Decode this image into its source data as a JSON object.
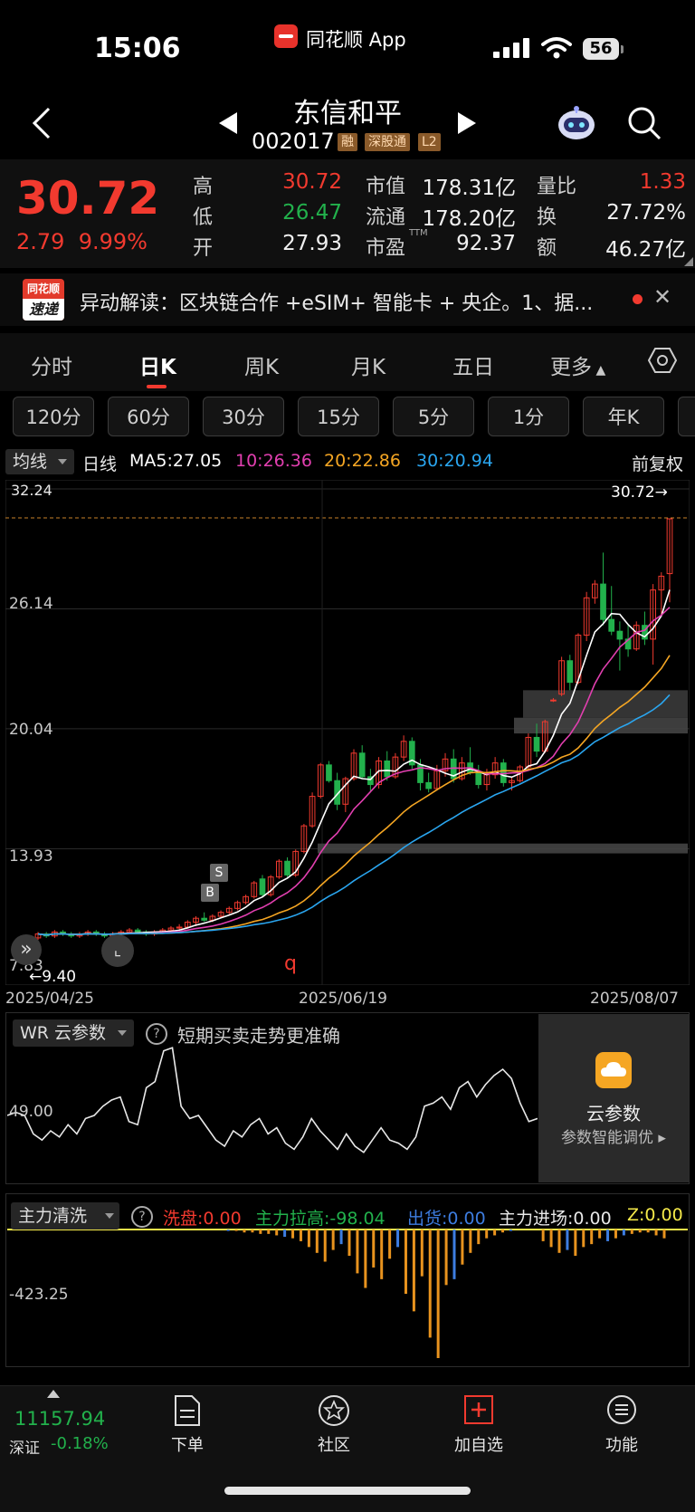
{
  "status_bar": {
    "time": "15:06",
    "app": "同花顺 App",
    "battery": "56"
  },
  "header": {
    "name": "东信和平",
    "code": "002017",
    "tags": [
      "融",
      "深股通",
      "L2"
    ]
  },
  "quote": {
    "price": "30.72",
    "change": "2.79",
    "change_pct": "9.99%",
    "rows": [
      {
        "l1": "高",
        "v1": "30.72",
        "c1": "#f23a2f",
        "l2": "市值",
        "v2": "178.31亿",
        "l3": "量比",
        "v3": "1.33",
        "c3": "#f23a2f"
      },
      {
        "l1": "低",
        "v1": "26.47",
        "c1": "#22b14c",
        "l2": "流通",
        "v2": "178.20亿",
        "l3": "换",
        "v3": "27.72%",
        "c3": "#f0f0f0"
      },
      {
        "l1": "开",
        "v1": "27.93",
        "c1": "#f0f0f0",
        "l2": "市盈",
        "v2": "92.37",
        "l3": "额",
        "v3": "46.27亿",
        "c3": "#f0f0f0"
      }
    ],
    "ttm": "TTM"
  },
  "news": {
    "logo_top": "同花顺",
    "logo_bottom": "速递",
    "text": "异动解读：区块链合作 +eSIM+ 智能卡 + 央企。1、据..."
  },
  "period_tabs": [
    "分时",
    "日K",
    "周K",
    "月K",
    "五日",
    "更多"
  ],
  "minute_buttons": [
    "120分",
    "60分",
    "30分",
    "15分",
    "5分",
    "1分",
    "年K"
  ],
  "ma_bar": {
    "select": "均线",
    "label": "日线",
    "ma5": "MA5:27.05",
    "ma10": "10:26.36",
    "ma20": "20:22.86",
    "ma30": "30:20.94",
    "adjust": "前复权",
    "colors": {
      "ma5": "#ffffff",
      "ma10": "#e23fb0",
      "ma20": "#f5a623",
      "ma30": "#2aa6f0"
    }
  },
  "kline": {
    "y_labels": [
      "32.24",
      "26.14",
      "20.04",
      "13.93",
      "7.83"
    ],
    "price_marker": "30.72→",
    "low_marker": "←9.40",
    "dates": [
      "2025/04/25",
      "2025/06/19",
      "2025/08/07"
    ],
    "marker_b": "B",
    "marker_s": "S",
    "q_marker": "q"
  },
  "chart_data": [
    {
      "type": "candlestick",
      "title": "日线",
      "ylim": [
        7.83,
        32.24
      ],
      "x_ticks": [
        "2025/04/25",
        "2025/06/19",
        "2025/08/07"
      ],
      "last_close": 30.72,
      "min_marker": 9.4,
      "candles": [
        [
          9.4,
          9.7,
          9.3,
          9.6
        ],
        [
          9.6,
          9.7,
          9.4,
          9.5
        ],
        [
          9.5,
          9.8,
          9.4,
          9.7
        ],
        [
          9.7,
          9.8,
          9.5,
          9.6
        ],
        [
          9.6,
          9.7,
          9.4,
          9.5
        ],
        [
          9.5,
          9.7,
          9.4,
          9.6
        ],
        [
          9.6,
          9.8,
          9.5,
          9.7
        ],
        [
          9.7,
          9.8,
          9.5,
          9.6
        ],
        [
          9.6,
          9.7,
          9.4,
          9.5
        ],
        [
          9.5,
          9.7,
          9.4,
          9.6
        ],
        [
          9.6,
          9.8,
          9.5,
          9.7
        ],
        [
          9.7,
          9.9,
          9.6,
          9.8
        ],
        [
          9.8,
          9.9,
          9.6,
          9.7
        ],
        [
          9.7,
          9.8,
          9.5,
          9.6
        ],
        [
          9.6,
          9.8,
          9.5,
          9.7
        ],
        [
          9.7,
          9.9,
          9.6,
          9.8
        ],
        [
          9.8,
          10.0,
          9.7,
          9.9
        ],
        [
          9.9,
          10.1,
          9.8,
          9.95
        ],
        [
          9.95,
          10.3,
          9.9,
          10.2
        ],
        [
          10.2,
          10.5,
          10.0,
          10.4
        ],
        [
          10.4,
          10.7,
          10.2,
          10.3
        ],
        [
          10.3,
          10.6,
          10.2,
          10.5
        ],
        [
          10.5,
          10.8,
          10.4,
          10.7
        ],
        [
          10.7,
          11.0,
          10.6,
          10.9
        ],
        [
          10.9,
          11.3,
          10.8,
          11.2
        ],
        [
          11.2,
          11.6,
          11.1,
          11.5
        ],
        [
          11.5,
          12.3,
          11.4,
          12.2
        ],
        [
          12.4,
          12.6,
          11.5,
          11.6
        ],
        [
          11.6,
          12.6,
          11.5,
          12.5
        ],
        [
          12.5,
          13.4,
          12.4,
          13.3
        ],
        [
          13.3,
          13.5,
          12.5,
          12.6
        ],
        [
          12.6,
          13.9,
          12.5,
          13.8
        ],
        [
          13.8,
          15.2,
          13.7,
          15.1
        ],
        [
          15.1,
          16.8,
          15.0,
          16.6
        ],
        [
          16.6,
          18.3,
          16.5,
          18.2
        ],
        [
          18.2,
          18.4,
          17.3,
          17.4
        ],
        [
          17.4,
          17.8,
          15.9,
          16.2
        ],
        [
          16.2,
          17.6,
          15.8,
          17.5
        ],
        [
          17.5,
          19.0,
          17.4,
          18.8
        ],
        [
          18.8,
          19.2,
          17.5,
          17.6
        ],
        [
          17.6,
          18.0,
          16.8,
          17.2
        ],
        [
          17.2,
          18.6,
          17.0,
          18.4
        ],
        [
          18.4,
          18.9,
          17.4,
          17.6
        ],
        [
          17.6,
          18.8,
          17.5,
          18.6
        ],
        [
          18.6,
          19.7,
          18.4,
          19.4
        ],
        [
          19.4,
          19.6,
          18.0,
          18.2
        ],
        [
          18.2,
          18.5,
          16.9,
          17.3
        ],
        [
          17.3,
          17.8,
          16.8,
          17.0
        ],
        [
          17.0,
          18.2,
          16.9,
          17.9
        ],
        [
          17.9,
          18.8,
          17.6,
          18.5
        ],
        [
          18.5,
          19.0,
          17.3,
          17.5
        ],
        [
          17.5,
          18.6,
          17.4,
          18.3
        ],
        [
          18.3,
          19.1,
          17.7,
          17.8
        ],
        [
          17.8,
          18.2,
          17.0,
          17.2
        ],
        [
          17.2,
          18.0,
          16.9,
          17.7
        ],
        [
          17.7,
          18.6,
          17.5,
          18.3
        ],
        [
          18.3,
          18.5,
          17.1,
          17.3
        ],
        [
          17.3,
          17.6,
          16.9,
          17.4
        ],
        [
          17.4,
          18.2,
          17.3,
          18.1
        ],
        [
          18.1,
          19.8,
          18.0,
          19.6
        ],
        [
          19.6,
          20.3,
          18.6,
          18.9
        ],
        [
          18.9,
          20.5,
          18.8,
          20.4
        ],
        [
          21.5,
          21.6,
          21.4,
          21.5
        ],
        [
          21.8,
          23.7,
          21.7,
          23.5
        ],
        [
          23.5,
          23.8,
          22.0,
          22.4
        ],
        [
          22.4,
          24.9,
          22.3,
          24.8
        ],
        [
          24.8,
          27.0,
          24.5,
          26.7
        ],
        [
          26.7,
          27.6,
          26.4,
          27.4
        ],
        [
          27.4,
          29.0,
          25.3,
          25.6
        ],
        [
          25.6,
          27.3,
          24.8,
          25.0
        ],
        [
          25.0,
          25.5,
          23.0,
          24.6
        ],
        [
          24.6,
          25.3,
          23.7,
          24.1
        ],
        [
          24.1,
          25.5,
          24.0,
          25.3
        ],
        [
          25.3,
          26.0,
          24.3,
          24.6
        ],
        [
          24.6,
          27.4,
          23.3,
          27.1
        ],
        [
          27.1,
          28.0,
          25.8,
          27.8
        ],
        [
          27.93,
          30.72,
          26.47,
          30.72
        ]
      ],
      "ma": {
        "MA5": 27.05,
        "MA10": 26.36,
        "MA20": 22.86,
        "MA30": 20.94
      }
    },
    {
      "type": "line",
      "title": "WR 云参数",
      "y_labels": [
        "49.00"
      ],
      "series": [
        {
          "name": "WR",
          "values": [
            40,
            42,
            40,
            28,
            24,
            30,
            26,
            34,
            28,
            38,
            40,
            46,
            50,
            52,
            36,
            34,
            58,
            62,
            82,
            84,
            46,
            38,
            40,
            32,
            24,
            20,
            30,
            26,
            34,
            38,
            28,
            32,
            22,
            18,
            26,
            38,
            30,
            24,
            18,
            28,
            20,
            16,
            24,
            32,
            24,
            22,
            18,
            26,
            46,
            48,
            52,
            44,
            58,
            62,
            52,
            60,
            66,
            70,
            64,
            48,
            36,
            38
          ]
        }
      ]
    },
    {
      "type": "bar",
      "title": "主力清洗",
      "y_labels": [
        "-423.25"
      ],
      "series": [
        {
          "name": "主力清洗",
          "values": [
            0,
            0,
            0,
            0,
            0,
            0,
            0,
            0,
            0,
            0,
            0,
            0,
            0,
            0,
            0,
            0,
            0,
            0,
            0,
            0,
            0,
            0,
            0,
            0,
            -5,
            -5,
            -10,
            -10,
            -15,
            -15,
            -20,
            -25,
            -30,
            -40,
            -60,
            -80,
            -110,
            -70,
            -50,
            -90,
            -150,
            -200,
            -130,
            -170,
            -100,
            -60,
            -220,
            -280,
            -160,
            -370,
            -440,
            -190,
            -170,
            -120,
            -80,
            -50,
            -30,
            -20,
            -10,
            -5,
            0,
            0,
            0,
            -40,
            -60,
            -80,
            -70,
            -90,
            -60,
            -50,
            -30,
            -40,
            -30,
            -20,
            -15,
            -10,
            -10,
            -20,
            -30
          ],
          "colors": "#e8931e / #3d7de0"
        }
      ]
    }
  ],
  "wr": {
    "select": "WR 云参数",
    "help": "?",
    "hint": "短期买卖走势更准确",
    "y_label": "49.00",
    "cloud_title": "云参数",
    "cloud_sub": "参数智能调优 ▸"
  },
  "zl": {
    "select": "主力清洗",
    "help": "?",
    "xipan": "洗盘:0.00",
    "lagao": "主力拉高:-98.04",
    "chuhuo": "出货:0.00",
    "jinchang": "主力进场:0.00",
    "z": "Z:0.00",
    "y_label": "-423.25"
  },
  "bottom_nav": {
    "index_value": "11157.94",
    "index_name": "深证",
    "index_change": "-0.18%",
    "items": [
      "下单",
      "社区",
      "加自选",
      "功能"
    ]
  }
}
